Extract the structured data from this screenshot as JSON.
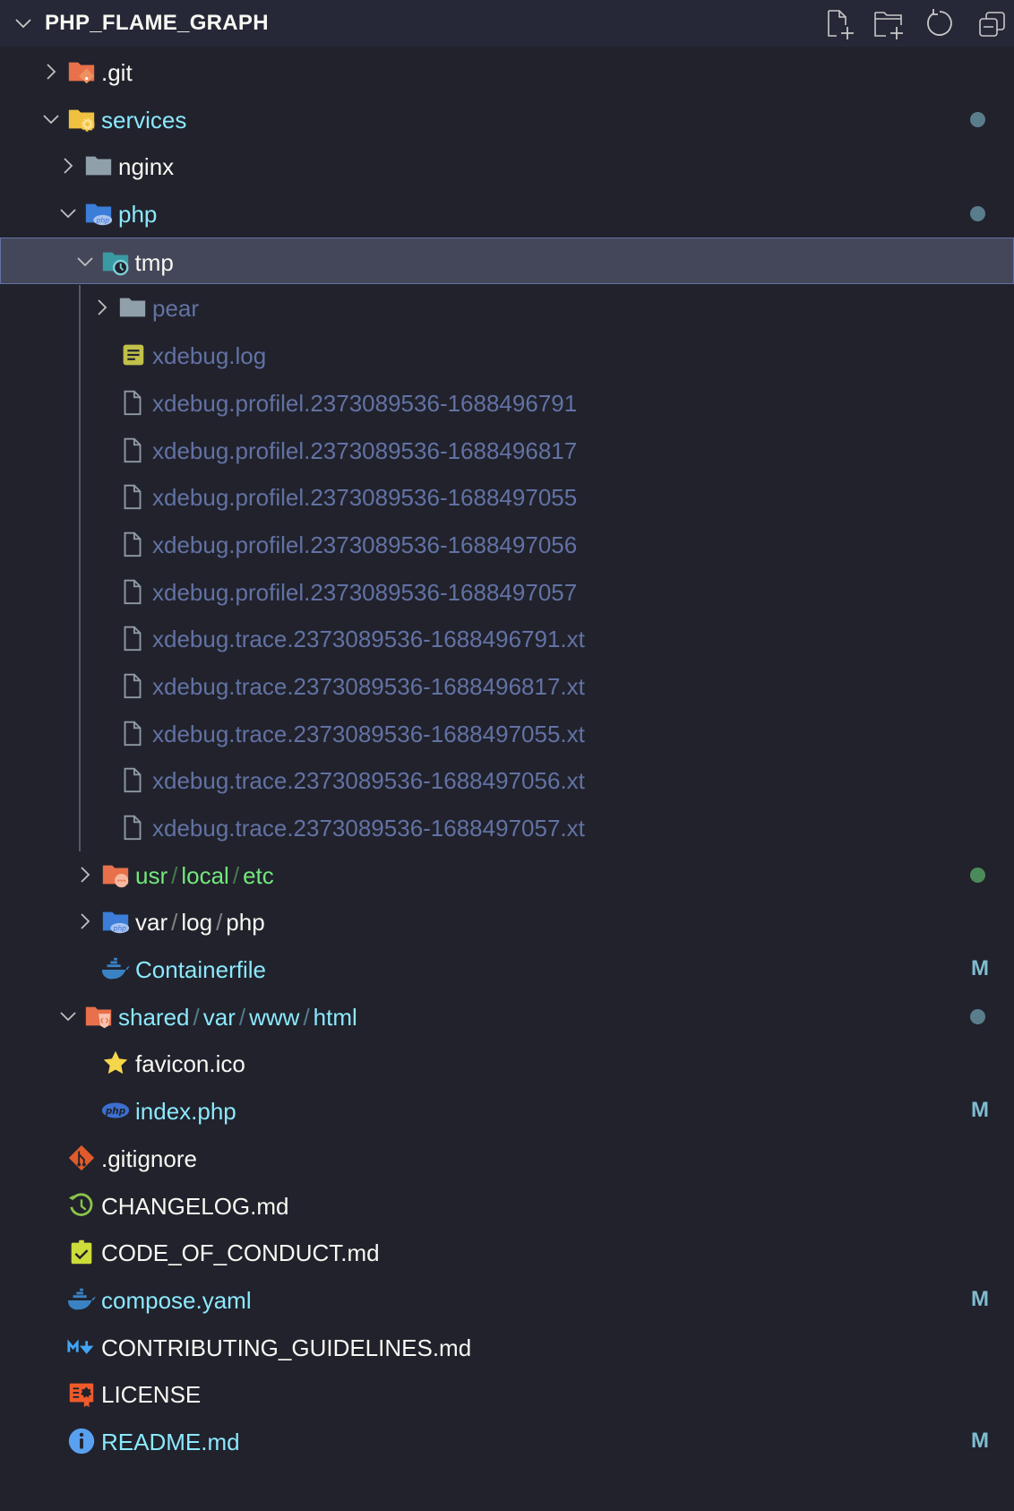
{
  "explorer": {
    "title": "PHP_FLAME_GRAPH",
    "actions": [
      {
        "name": "new-file-button",
        "icon": "new-file-icon"
      },
      {
        "name": "new-folder-button",
        "icon": "new-folder-icon"
      },
      {
        "name": "refresh-button",
        "icon": "refresh-icon"
      },
      {
        "name": "collapse-all-button",
        "icon": "collapse-all-icon"
      }
    ]
  },
  "colors": {
    "background": "#21222c",
    "header": "#262837",
    "selection": "#44475a",
    "modified": "#8be9fd",
    "untracked": "#72e87a",
    "ignored": "#6272a4"
  },
  "tree": [
    {
      "segments": [
        ".git"
      ],
      "level": 0,
      "folder": true,
      "expanded": false,
      "icon": "folder-git-icon"
    },
    {
      "segments": [
        "services"
      ],
      "level": 0,
      "folder": true,
      "expanded": true,
      "icon": "folder-config-icon",
      "status": "mod",
      "deco": "dot",
      "deco_color": "#5a7d8c"
    },
    {
      "segments": [
        "nginx"
      ],
      "level": 1,
      "folder": true,
      "expanded": false,
      "icon": "folder-icon"
    },
    {
      "segments": [
        "php"
      ],
      "level": 1,
      "folder": true,
      "expanded": true,
      "icon": "folder-php-icon",
      "status": "mod",
      "deco": "dot",
      "deco_color": "#5a7d8c"
    },
    {
      "segments": [
        "tmp"
      ],
      "level": 2,
      "folder": true,
      "expanded": true,
      "icon": "folder-temp-icon",
      "selected": true
    },
    {
      "segments": [
        "pear"
      ],
      "level": 3,
      "folder": true,
      "expanded": false,
      "icon": "folder-icon",
      "status": "ignored"
    },
    {
      "segments": [
        "xdebug.log"
      ],
      "level": 3,
      "folder": false,
      "icon": "log-file-icon",
      "status": "ignored"
    },
    {
      "segments": [
        "xdebug.profilel.2373089536-1688496791"
      ],
      "level": 3,
      "folder": false,
      "icon": "file-icon",
      "status": "ignored"
    },
    {
      "segments": [
        "xdebug.profilel.2373089536-1688496817"
      ],
      "level": 3,
      "folder": false,
      "icon": "file-icon",
      "status": "ignored"
    },
    {
      "segments": [
        "xdebug.profilel.2373089536-1688497055"
      ],
      "level": 3,
      "folder": false,
      "icon": "file-icon",
      "status": "ignored"
    },
    {
      "segments": [
        "xdebug.profilel.2373089536-1688497056"
      ],
      "level": 3,
      "folder": false,
      "icon": "file-icon",
      "status": "ignored"
    },
    {
      "segments": [
        "xdebug.profilel.2373089536-1688497057"
      ],
      "level": 3,
      "folder": false,
      "icon": "file-icon",
      "status": "ignored"
    },
    {
      "segments": [
        "xdebug.trace.2373089536-1688496791.xt"
      ],
      "level": 3,
      "folder": false,
      "icon": "file-icon",
      "status": "ignored"
    },
    {
      "segments": [
        "xdebug.trace.2373089536-1688496817.xt"
      ],
      "level": 3,
      "folder": false,
      "icon": "file-icon",
      "status": "ignored"
    },
    {
      "segments": [
        "xdebug.trace.2373089536-1688497055.xt"
      ],
      "level": 3,
      "folder": false,
      "icon": "file-icon",
      "status": "ignored"
    },
    {
      "segments": [
        "xdebug.trace.2373089536-1688497056.xt"
      ],
      "level": 3,
      "folder": false,
      "icon": "file-icon",
      "status": "ignored"
    },
    {
      "segments": [
        "xdebug.trace.2373089536-1688497057.xt"
      ],
      "level": 3,
      "folder": false,
      "icon": "file-icon",
      "status": "ignored"
    },
    {
      "segments": [
        "usr",
        "local",
        "etc"
      ],
      "level": 2,
      "folder": true,
      "expanded": false,
      "icon": "folder-misc-icon",
      "status": "untracked",
      "deco": "dot",
      "deco_color": "#4b8a5a"
    },
    {
      "segments": [
        "var",
        "log",
        "php"
      ],
      "level": 2,
      "folder": true,
      "expanded": false,
      "icon": "folder-php-icon"
    },
    {
      "segments": [
        "Containerfile"
      ],
      "level": 2,
      "folder": false,
      "icon": "docker-icon",
      "status": "mod",
      "deco": "M"
    },
    {
      "segments": [
        "shared",
        "var",
        "www",
        "html"
      ],
      "level": 1,
      "folder": true,
      "expanded": true,
      "icon": "folder-html-icon",
      "status": "mod",
      "deco": "dot",
      "deco_color": "#5a7d8c"
    },
    {
      "segments": [
        "favicon.ico"
      ],
      "level": 2,
      "folder": false,
      "icon": "star-icon"
    },
    {
      "segments": [
        "index.php"
      ],
      "level": 2,
      "folder": false,
      "icon": "php-icon",
      "status": "mod",
      "deco": "M"
    },
    {
      "segments": [
        ".gitignore"
      ],
      "level": 0,
      "folder": false,
      "icon": "git-icon"
    },
    {
      "segments": [
        "CHANGELOG.md"
      ],
      "level": 0,
      "folder": false,
      "icon": "changelog-icon"
    },
    {
      "segments": [
        "CODE_OF_CONDUCT.md"
      ],
      "level": 0,
      "folder": false,
      "icon": "conduct-icon"
    },
    {
      "segments": [
        "compose.yaml"
      ],
      "level": 0,
      "folder": false,
      "icon": "docker-icon",
      "status": "mod",
      "deco": "M"
    },
    {
      "segments": [
        "CONTRIBUTING_GUIDELINES.md"
      ],
      "level": 0,
      "folder": false,
      "icon": "markdown-icon"
    },
    {
      "segments": [
        "LICENSE"
      ],
      "level": 0,
      "folder": false,
      "icon": "license-icon"
    },
    {
      "segments": [
        "README.md"
      ],
      "level": 0,
      "folder": false,
      "icon": "info-icon",
      "status": "mod",
      "deco": "M"
    }
  ]
}
